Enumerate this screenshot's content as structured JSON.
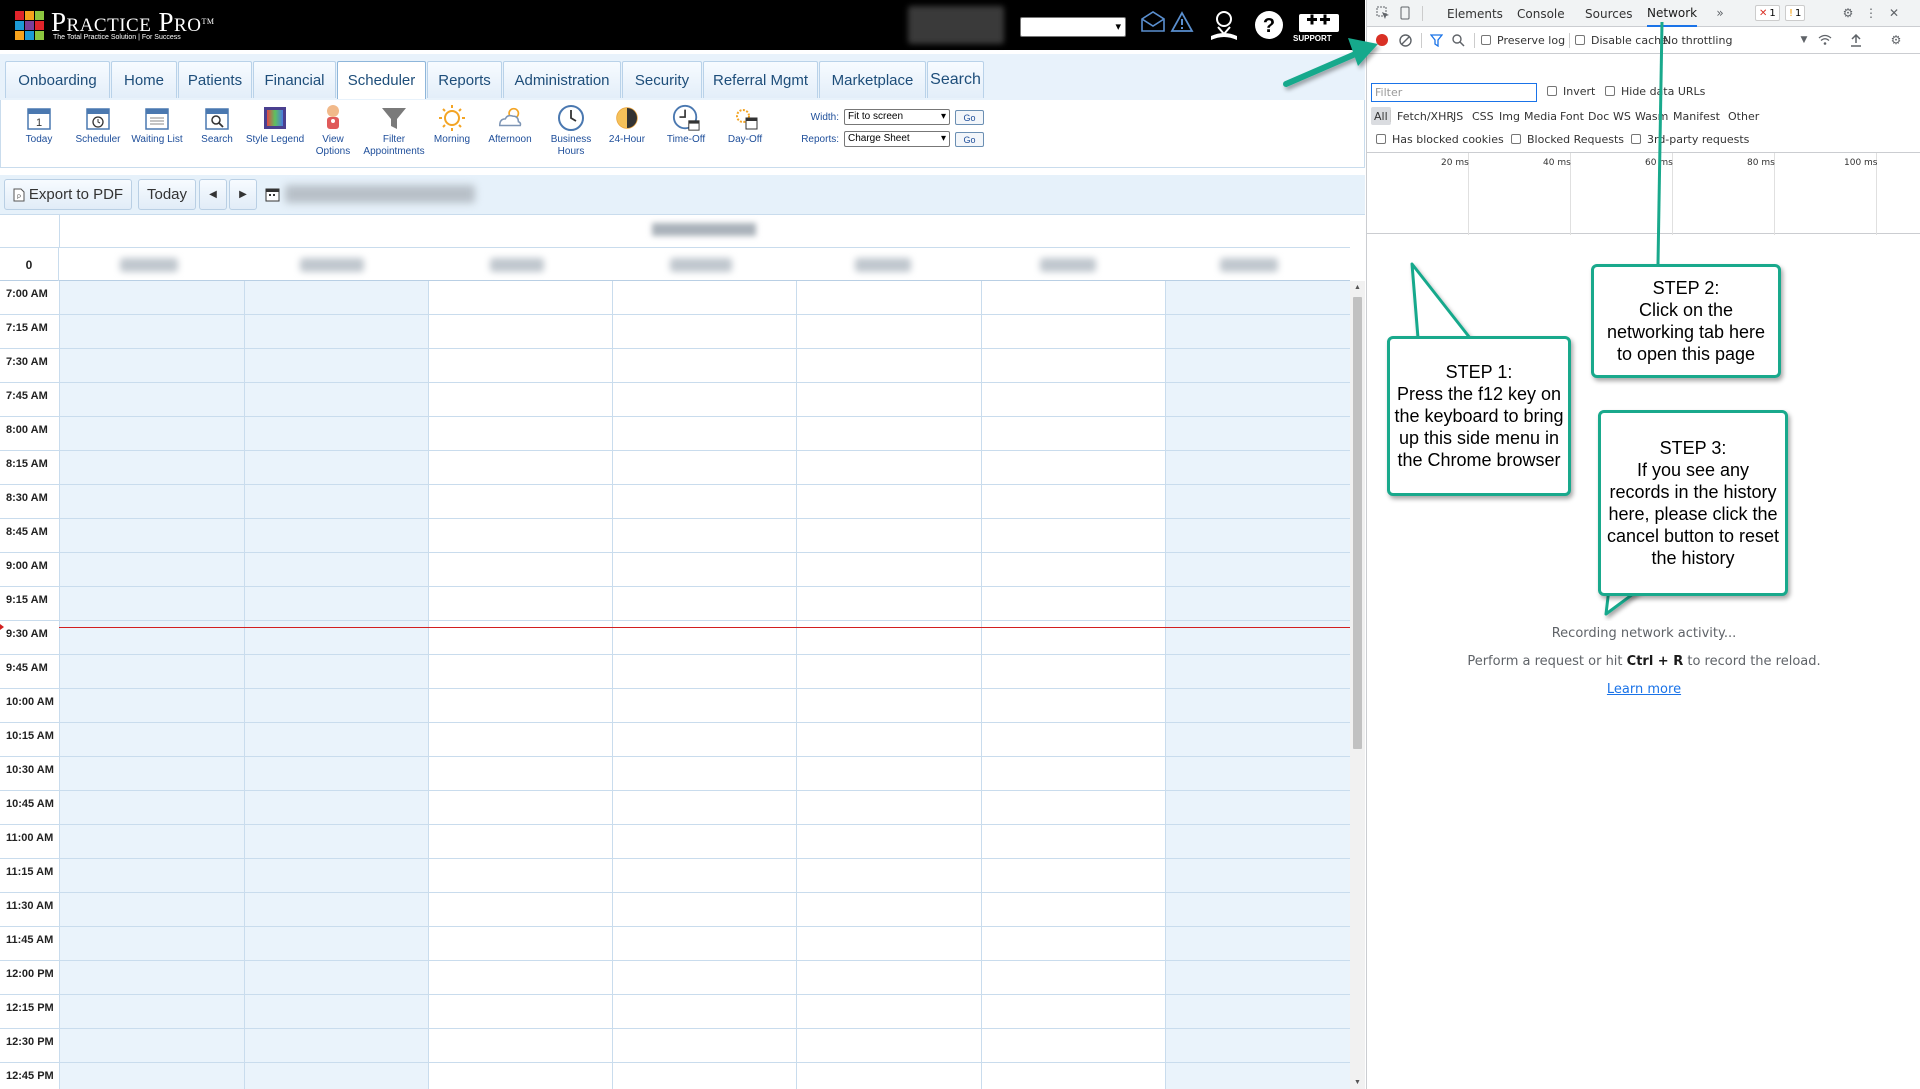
{
  "app": {
    "logo_text": "Practice Pro",
    "logo_tm": "TM",
    "logo_tagline": "The Total Practice Solution | For Success",
    "support_label": "SUPPORT"
  },
  "nav": {
    "tabs": [
      "Onboarding",
      "Home",
      "Patients",
      "Financial",
      "Scheduler",
      "Reports",
      "Administration",
      "Security",
      "Referral Mgmt",
      "Marketplace",
      "Search"
    ],
    "active": "Scheduler"
  },
  "toolbar": {
    "tools": [
      {
        "label": "Today",
        "icon": "calendar-today-icon"
      },
      {
        "label": "Scheduler",
        "icon": "calendar-scheduler-icon"
      },
      {
        "label": "Waiting List",
        "icon": "calendar-list-icon"
      },
      {
        "label": "Search",
        "icon": "calendar-search-icon"
      },
      {
        "label": "Style Legend",
        "icon": "style-legend-icon"
      },
      {
        "label": "View Options",
        "icon": "view-options-icon"
      },
      {
        "label": "Filter Appointments",
        "icon": "filter-icon"
      },
      {
        "label": "Morning",
        "icon": "sun-icon"
      },
      {
        "label": "Afternoon",
        "icon": "cloud-sun-icon"
      },
      {
        "label": "Business Hours",
        "icon": "clock-icon"
      },
      {
        "label": "24-Hour",
        "icon": "half-moon-icon"
      },
      {
        "label": "Time-Off",
        "icon": "clock-calendar-icon"
      },
      {
        "label": "Day-Off",
        "icon": "sun-calendar-icon"
      }
    ],
    "width_label": "Width:",
    "width_value": "Fit to screen",
    "reports_label": "Reports:",
    "reports_value": "Charge Sheet",
    "go_label": "Go"
  },
  "actions": {
    "export_label": "Export to PDF",
    "today_label": "Today"
  },
  "calendar": {
    "zero_label": "0",
    "times": [
      "7:00 AM",
      "7:15 AM",
      "7:30 AM",
      "7:45 AM",
      "8:00 AM",
      "8:15 AM",
      "8:30 AM",
      "8:45 AM",
      "9:00 AM",
      "9:15 AM",
      "9:30 AM",
      "9:45 AM",
      "10:00 AM",
      "10:15 AM",
      "10:30 AM",
      "10:45 AM",
      "11:00 AM",
      "11:15 AM",
      "11:30 AM",
      "11:45 AM",
      "12:00 PM",
      "12:15 PM",
      "12:30 PM",
      "12:45 PM"
    ]
  },
  "devtools": {
    "tabs": [
      "Elements",
      "Console",
      "Sources",
      "Network"
    ],
    "active_tab": "Network",
    "error_count": "1",
    "warning_count": "1",
    "preserve_log": "Preserve log",
    "disable_cache": "Disable cache",
    "throttling": "No throttling",
    "filter_placeholder": "Filter",
    "invert": "Invert",
    "hide_data_urls": "Hide data URLs",
    "types": [
      "All",
      "Fetch/XHR",
      "JS",
      "CSS",
      "Img",
      "Media",
      "Font",
      "Doc",
      "WS",
      "Wasm",
      "Manifest",
      "Other"
    ],
    "has_blocked_cookies": "Has blocked cookies",
    "blocked_requests": "Blocked Requests",
    "third_party": "3rd-party requests",
    "timeline_labels": [
      "20 ms",
      "40 ms",
      "60 ms",
      "80 ms",
      "100 ms"
    ],
    "recording": "Recording network activity...",
    "perform_prefix": "Perform a request or hit ",
    "perform_keys": "Ctrl + R",
    "perform_suffix": " to record the reload.",
    "learn_more": "Learn more"
  },
  "annotations": {
    "step1": "STEP 1:\nPress the f12 key on the keyboard to bring up this side menu in the Chrome  browser",
    "step2": "STEP 2:\nClick on the networking tab here to open this page",
    "step3": "STEP 3:\nIf you see any records in the history here, please click the cancel button to reset the history"
  },
  "colors": {
    "accent_teal": "#19a98c",
    "devtools_blue": "#1a73e8",
    "now_line": "#d21f1f",
    "nav_text": "#1e4e7a"
  }
}
